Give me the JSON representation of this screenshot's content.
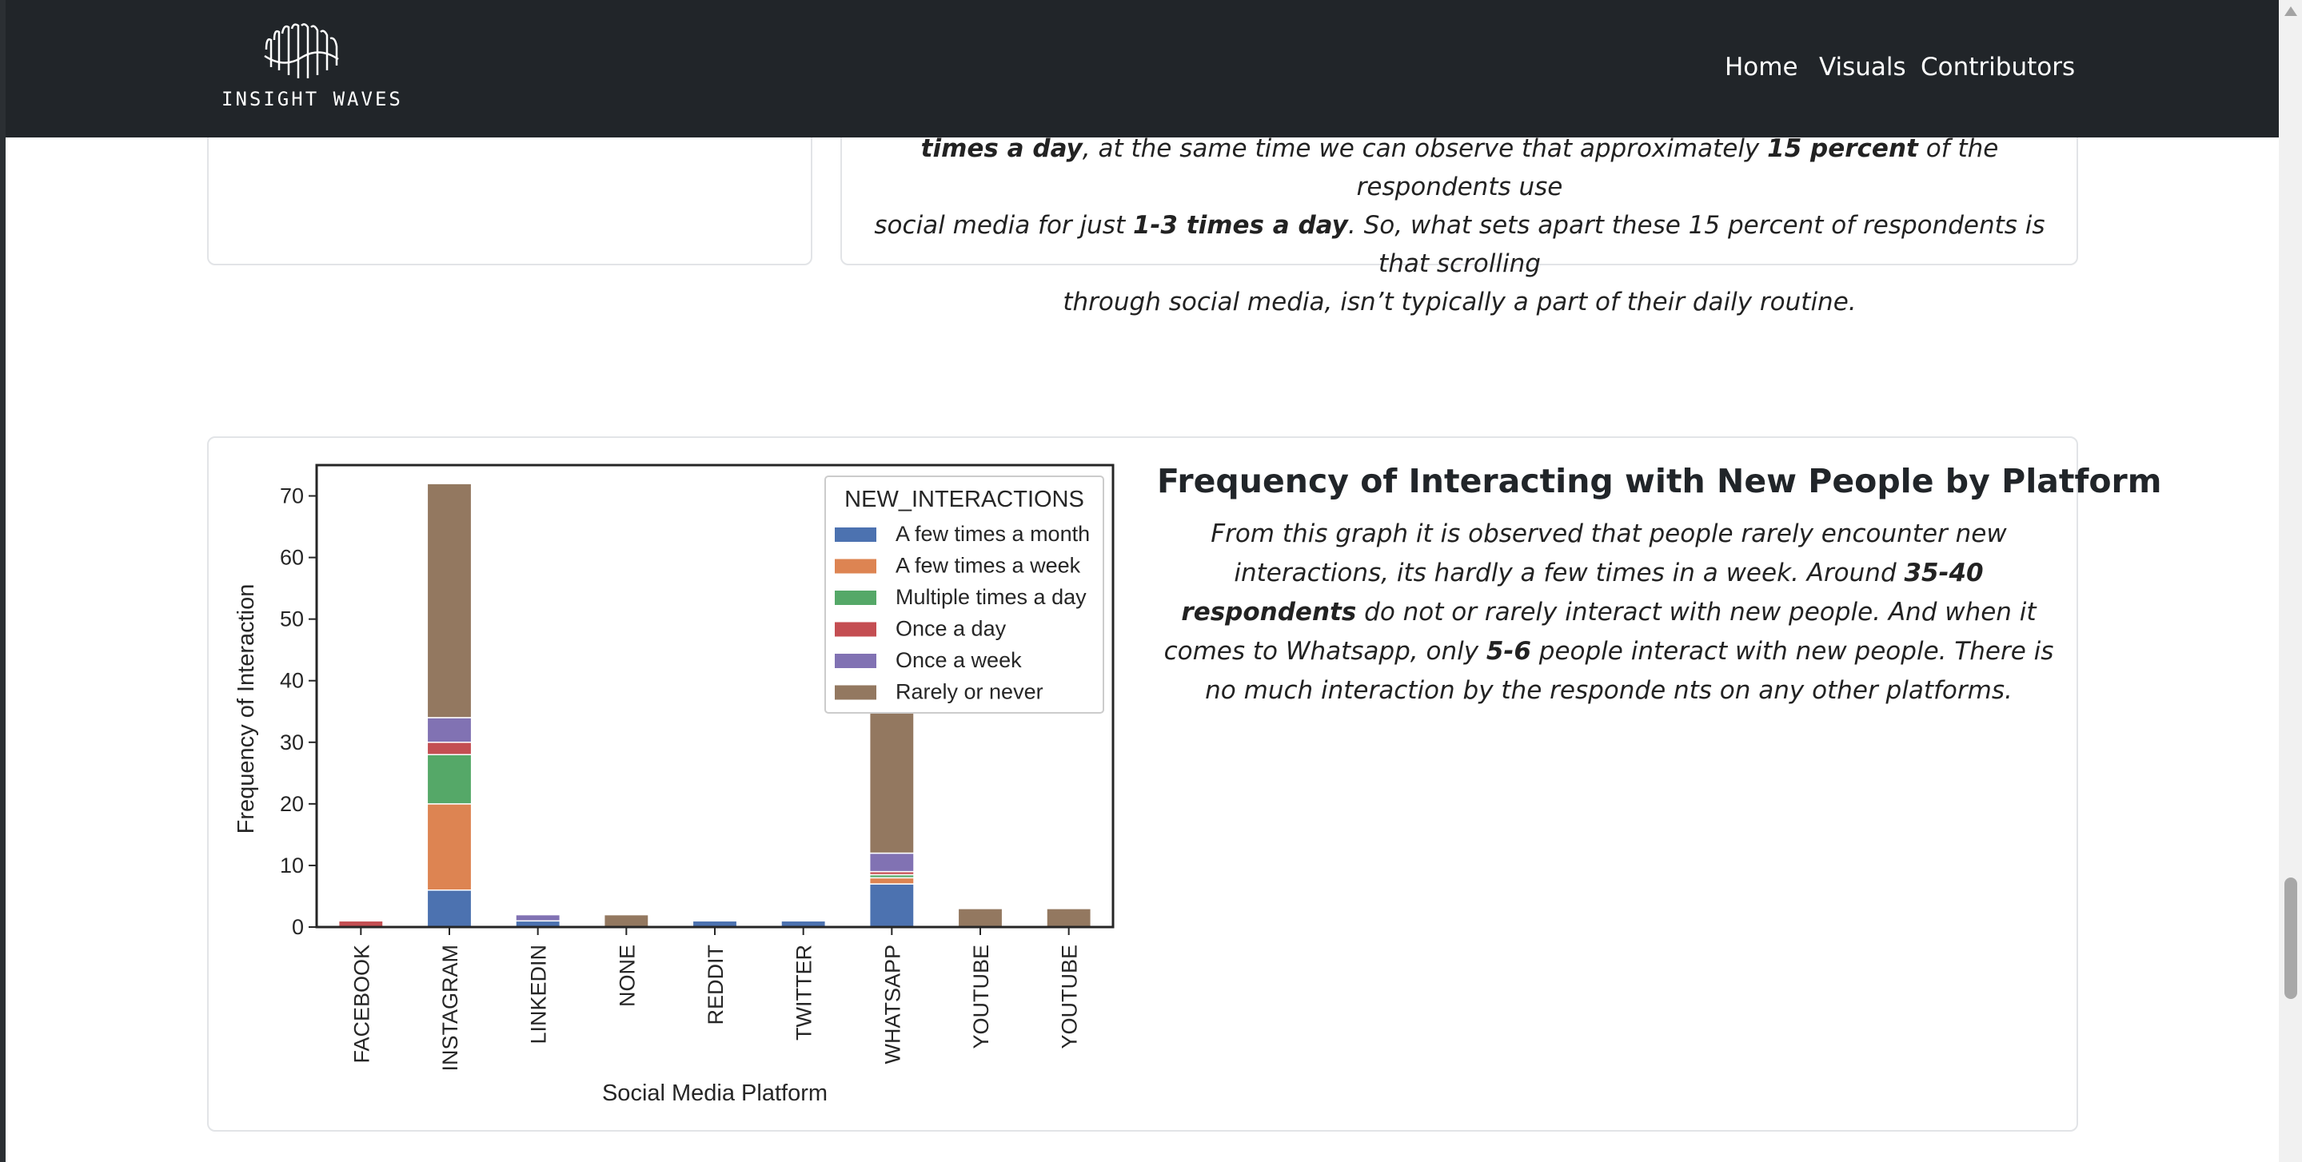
{
  "nav": {
    "logo_text": "INSIGHT WAVES",
    "links": [
      "Home",
      "Visuals",
      "Contributors"
    ]
  },
  "previous_section": {
    "line1_bold_start": "times a day",
    "line1_rest": ", at the same time we can observe that approximately ",
    "line1_bold_pct": "15 percent",
    "line1_end": " of the respondents use",
    "line2_start": "social media for just ",
    "line2_bold": "1-3 times a day",
    "line2_end": ". So, what sets apart these 15 percent of respondents is that scrolling",
    "line3": "through social media, isn’t typically a part of their daily routine."
  },
  "section": {
    "title": "Frequency of Interacting with New People by Platform",
    "body_1": "From this graph it is observed that people rarely encounter new interactions, its hardly a few times in a week. Around ",
    "body_bold_1": "35-40 respondents",
    "body_2": " do not or rarely interact with new people. And when it comes to Whatsapp, only ",
    "body_bold_2": "5-6",
    "body_3": " people interact with new people. There is no much interaction by the responde nts on any other platforms."
  },
  "chart_data": {
    "type": "bar",
    "stacked": true,
    "xlabel": "Social Media Platform",
    "ylabel": "Frequency of Interaction",
    "ylim": [
      0,
      75
    ],
    "yticks": [
      0,
      10,
      20,
      30,
      40,
      50,
      60,
      70
    ],
    "categories": [
      "FACEBOOK",
      "INSTAGRAM",
      "LINKEDIN",
      "NONE",
      "REDDIT",
      "TWITTER",
      "WHATSAPP",
      "YOUTUBE",
      "YOUTUBE"
    ],
    "legend_title": "NEW_INTERACTIONS",
    "legend_position": "top-right",
    "series": [
      {
        "name": "A few times a month",
        "color": "#4c72b0",
        "values": [
          0,
          6,
          1,
          0,
          1,
          1,
          7,
          0,
          0
        ]
      },
      {
        "name": "A few times a week",
        "color": "#dd8452",
        "values": [
          0,
          14,
          0,
          0,
          0,
          0,
          1,
          0,
          0
        ]
      },
      {
        "name": "Multiple times a day",
        "color": "#55a868",
        "values": [
          0,
          8,
          0,
          0,
          0,
          0,
          0.5,
          0,
          0
        ]
      },
      {
        "name": "Once a day",
        "color": "#c44e52",
        "values": [
          1,
          2,
          0,
          0,
          0,
          0,
          0.5,
          0,
          0
        ]
      },
      {
        "name": "Once a week",
        "color": "#8172b3",
        "values": [
          0,
          4,
          1,
          0,
          0,
          0,
          3,
          0,
          0
        ]
      },
      {
        "name": "Rarely or never",
        "color": "#937860",
        "values": [
          0,
          38,
          0,
          2,
          0,
          0,
          23,
          3,
          3
        ]
      }
    ]
  }
}
